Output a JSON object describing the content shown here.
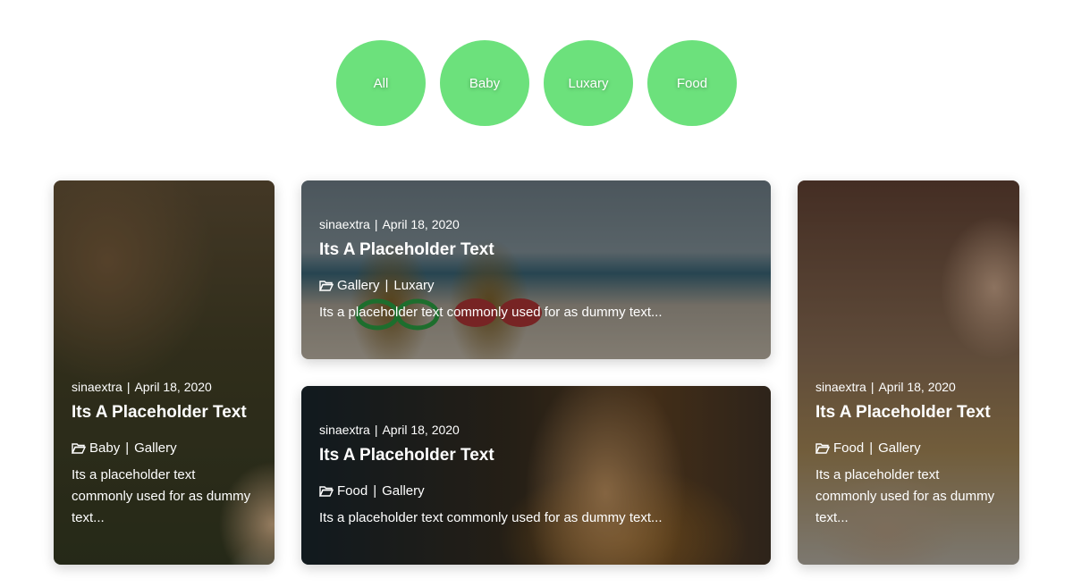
{
  "filters": [
    {
      "label": "All"
    },
    {
      "label": "Baby"
    },
    {
      "label": "Luxary"
    },
    {
      "label": "Food"
    }
  ],
  "posts": [
    {
      "author": "sinaextra",
      "date": "April 18, 2020",
      "title": "Its A Placeholder Text",
      "categories": [
        "Baby",
        "Gallery"
      ],
      "excerpt": "Its a placeholder text commonly used for as dummy text..."
    },
    {
      "author": "sinaextra",
      "date": "April 18, 2020",
      "title": "Its A Placeholder Text",
      "categories": [
        "Gallery",
        "Luxary"
      ],
      "excerpt": "Its a placeholder text commonly used for as dummy text..."
    },
    {
      "author": "sinaextra",
      "date": "April 18, 2020",
      "title": "Its A Placeholder Text",
      "categories": [
        "Food",
        "Gallery"
      ],
      "excerpt": "Its a placeholder text commonly used for as dummy text..."
    },
    {
      "author": "sinaextra",
      "date": "April 18, 2020",
      "title": "Its A Placeholder Text",
      "categories": [
        "Food",
        "Gallery"
      ],
      "excerpt": "Its a placeholder text commonly used for as dummy text..."
    }
  ],
  "icons": {
    "category": "folder-open-icon"
  },
  "colors": {
    "filter_accent": "#6ce17c"
  }
}
